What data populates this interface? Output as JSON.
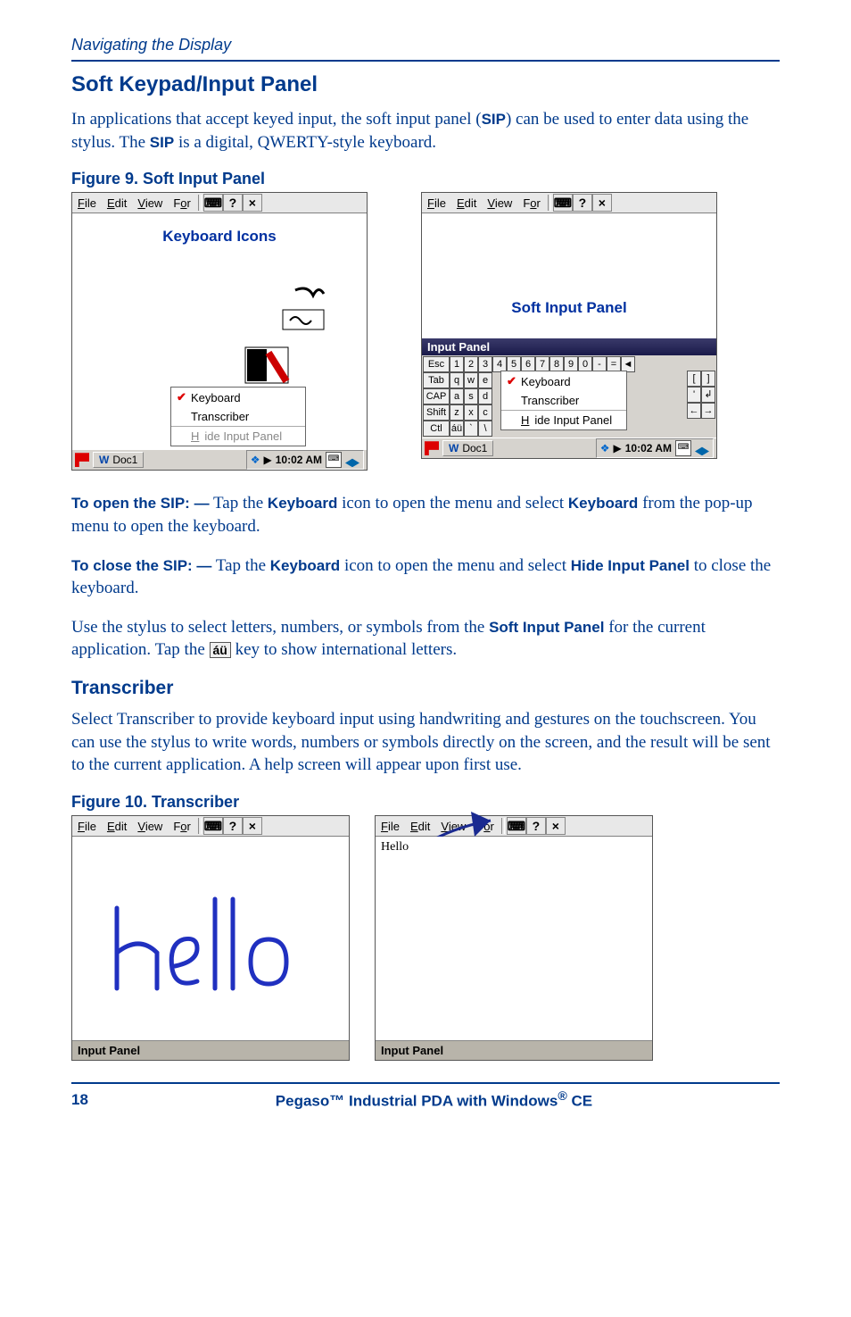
{
  "running_head": "Navigating the Display",
  "h1": "Soft Keypad/Input Panel",
  "intro_a": "In applications that accept keyed input, the soft input panel (",
  "intro_sip": "SIP",
  "intro_b": ") can be used to enter data using the stylus. The ",
  "intro_sip2": "SIP",
  "intro_c": " is a digital, QWERTY-style keyboard.",
  "fig9_caption": "Figure 9. Soft Input Panel",
  "kbd_icons_label": "Keyboard Icons",
  "sip_label": "Soft Input Panel",
  "menubar": {
    "file": "File",
    "edit": "Edit",
    "view": "View",
    "format": "For",
    "help": "?",
    "close": "×"
  },
  "popup": {
    "keyboard": "Keyboard",
    "transcriber": "Transcriber",
    "hide": "Hide Input Panel"
  },
  "taskbar": {
    "doc": "Doc1",
    "time": "10:02 AM"
  },
  "sip_kbd_title": "Input Panel",
  "kbd_rows": {
    "r1_lead": "Esc",
    "r1": [
      "1",
      "2",
      "3",
      "4",
      "5",
      "6",
      "7",
      "8",
      "9",
      "0",
      "-",
      "=",
      "◄"
    ],
    "r2_lead": "Tab",
    "r2": [
      "q",
      "w",
      "e"
    ],
    "r3_lead": "CAP",
    "r3": [
      "a",
      "s",
      "d"
    ],
    "r4_lead": "Shift",
    "r4": [
      "z",
      "x",
      "c"
    ],
    "r5_lead": "Ctl",
    "r5": [
      "áü",
      "`",
      "\\"
    ]
  },
  "open_sip_lead": "To open the SIP:  —",
  "open_sip_a": " Tap the ",
  "open_sip_kbd": "Keyboard",
  "open_sip_b": " icon to open the menu and select ",
  "open_sip_kbd2": "Keyboard",
  "open_sip_c": " from the pop-up menu to open the keyboard.",
  "close_sip_lead": "To close the SIP: —",
  "close_sip_a": " Tap the ",
  "close_sip_kbd": "Keyboard",
  "close_sip_b": " icon to open the menu and select ",
  "close_sip_hide": "Hide Input Panel",
  "close_sip_c": " to close the keyboard.",
  "stylus_a": "Use the stylus to select letters, numbers, or symbols from the ",
  "stylus_sip": "Soft Input Panel",
  "stylus_b": " for the current application. Tap the ",
  "au_key": "áü",
  "stylus_c": " key to show international letters.",
  "h2": "Transcriber",
  "trans_body": "Select Transcriber to provide keyboard input using handwriting and gestures on the touchscreen. You can use the stylus to write words, numbers or symbols directly on the screen, and the result will be sent to the current application. A help screen will appear upon first use.",
  "fig10_caption": "Figure 10. Transcriber",
  "fig10_result": "Hello",
  "input_panel_bar": "Input Panel",
  "footer_page": "18",
  "footer_title_a": "Pegaso™ Industrial PDA with Windows",
  "footer_title_b": " CE"
}
